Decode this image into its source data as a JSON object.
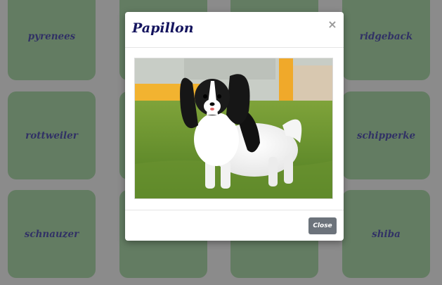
{
  "tiles": {
    "r1c1": "pyrenees",
    "r1c4": "ridgeback",
    "r2c1": "rottweiler",
    "r2c4": "schipperke",
    "r3c1": "schnauzer",
    "r3c4": "shiba"
  },
  "modal": {
    "title": "Papillon",
    "close_icon": "×",
    "close_label": "Close",
    "image_alt": "Papillon"
  },
  "colors": {
    "tile": "#5b7f59",
    "tile_text": "#14145e",
    "backdrop": "#949494",
    "close_button": "#6c737b"
  }
}
